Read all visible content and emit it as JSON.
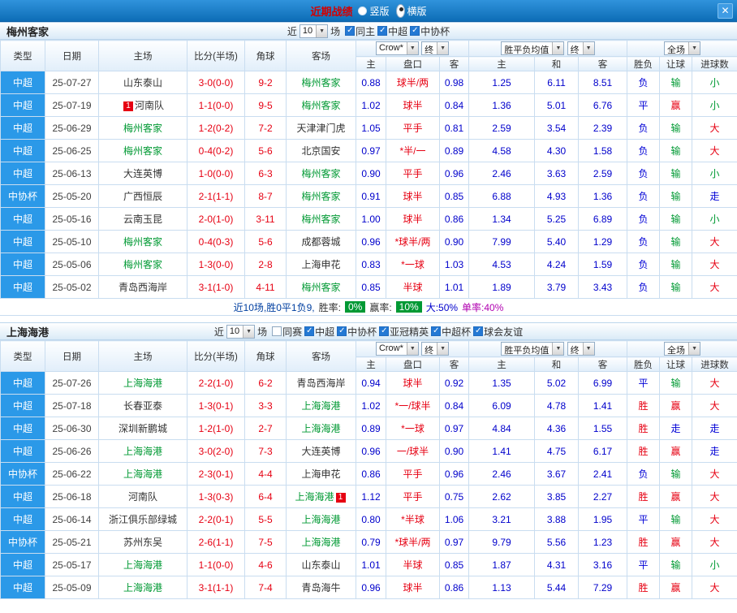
{
  "titlebar": {
    "title": "近期战绩",
    "radios": [
      {
        "label": "竖版",
        "selected": false
      },
      {
        "label": "横版",
        "selected": true
      }
    ],
    "close_icon": "✕"
  },
  "filters_common": {
    "near": "近",
    "count": "10",
    "games": "场"
  },
  "table_header": {
    "static": [
      "类型",
      "日期",
      "主场",
      "比分(半场)",
      "角球",
      "客场"
    ],
    "dd": [
      "Crow*",
      "终",
      "胜平负均值",
      "终",
      "全场"
    ],
    "sub": [
      "主",
      "盘口",
      "客",
      "主",
      "和",
      "客",
      "胜负",
      "让球",
      "进球数"
    ]
  },
  "colors": {
    "red": "#e60012",
    "green": "#009933",
    "blue": "#0000d6",
    "odds": "#0000cc",
    "date": "#404040",
    "opponent": "#333333"
  },
  "type_colors": {
    "中超": "#2b99e8",
    "中协杯": "#2b99e8"
  },
  "sections": [
    {
      "team": "梅州客家",
      "checkboxes": [
        {
          "label": "同主",
          "checked": true
        },
        {
          "label": "中超",
          "checked": true
        },
        {
          "label": "中协杯",
          "checked": true
        }
      ],
      "rows": [
        {
          "type": "中超",
          "date": "25-07-27",
          "home": {
            "name": "山东泰山"
          },
          "score": "3-0(0-0)",
          "corner": "9-2",
          "away": {
            "name": "梅州客家",
            "focus": true
          },
          "o1": "0.88",
          "pan": "球半/两",
          "o2": "0.98",
          "m1": "1.25",
          "m2": "6.11",
          "m3": "8.51",
          "res": [
            "负",
            "blue"
          ],
          "let": [
            "输",
            "green"
          ],
          "goal": [
            "小",
            "green"
          ]
        },
        {
          "type": "中超",
          "date": "25-07-19",
          "home": {
            "name": "河南队",
            "badge": "1",
            "badge_pos": "before"
          },
          "score": "1-1(0-0)",
          "corner": "9-5",
          "away": {
            "name": "梅州客家",
            "focus": true
          },
          "o1": "1.02",
          "pan": "球半",
          "o2": "0.84",
          "m1": "1.36",
          "m2": "5.01",
          "m3": "6.76",
          "res": [
            "平",
            "blue"
          ],
          "let": [
            "赢",
            "red"
          ],
          "goal": [
            "小",
            "green"
          ]
        },
        {
          "type": "中超",
          "date": "25-06-29",
          "home": {
            "name": "梅州客家",
            "focus": true
          },
          "score": "1-2(0-2)",
          "corner": "7-2",
          "away": {
            "name": "天津津门虎"
          },
          "o1": "1.05",
          "pan": "平手",
          "o2": "0.81",
          "m1": "2.59",
          "m2": "3.54",
          "m3": "2.39",
          "res": [
            "负",
            "blue"
          ],
          "let": [
            "输",
            "green"
          ],
          "goal": [
            "大",
            "red"
          ]
        },
        {
          "type": "中超",
          "date": "25-06-25",
          "home": {
            "name": "梅州客家",
            "focus": true
          },
          "score": "0-4(0-2)",
          "corner": "5-6",
          "away": {
            "name": "北京国安"
          },
          "o1": "0.97",
          "pan": "*半/一",
          "o2": "0.89",
          "m1": "4.58",
          "m2": "4.30",
          "m3": "1.58",
          "res": [
            "负",
            "blue"
          ],
          "let": [
            "输",
            "green"
          ],
          "goal": [
            "大",
            "red"
          ]
        },
        {
          "type": "中超",
          "date": "25-06-13",
          "home": {
            "name": "大连英博"
          },
          "score": "1-0(0-0)",
          "corner": "6-3",
          "away": {
            "name": "梅州客家",
            "focus": true
          },
          "o1": "0.90",
          "pan": "平手",
          "o2": "0.96",
          "m1": "2.46",
          "m2": "3.63",
          "m3": "2.59",
          "res": [
            "负",
            "blue"
          ],
          "let": [
            "输",
            "green"
          ],
          "goal": [
            "小",
            "green"
          ]
        },
        {
          "type": "中协杯",
          "date": "25-05-20",
          "home": {
            "name": "广西恒辰"
          },
          "score": "2-1(1-1)",
          "corner": "8-7",
          "away": {
            "name": "梅州客家",
            "focus": true
          },
          "o1": "0.91",
          "pan": "球半",
          "o2": "0.85",
          "m1": "6.88",
          "m2": "4.93",
          "m3": "1.36",
          "res": [
            "负",
            "blue"
          ],
          "let": [
            "输",
            "green"
          ],
          "goal": [
            "走",
            "blue"
          ]
        },
        {
          "type": "中超",
          "date": "25-05-16",
          "home": {
            "name": "云南玉昆"
          },
          "score": "2-0(1-0)",
          "corner": "3-11",
          "away": {
            "name": "梅州客家",
            "focus": true
          },
          "o1": "1.00",
          "pan": "球半",
          "o2": "0.86",
          "m1": "1.34",
          "m2": "5.25",
          "m3": "6.89",
          "res": [
            "负",
            "blue"
          ],
          "let": [
            "输",
            "green"
          ],
          "goal": [
            "小",
            "green"
          ]
        },
        {
          "type": "中超",
          "date": "25-05-10",
          "home": {
            "name": "梅州客家",
            "focus": true
          },
          "score": "0-4(0-3)",
          "corner": "5-6",
          "away": {
            "name": "成都蓉城"
          },
          "o1": "0.96",
          "pan": "*球半/两",
          "o2": "0.90",
          "m1": "7.99",
          "m2": "5.40",
          "m3": "1.29",
          "res": [
            "负",
            "blue"
          ],
          "let": [
            "输",
            "green"
          ],
          "goal": [
            "大",
            "red"
          ]
        },
        {
          "type": "中超",
          "date": "25-05-06",
          "home": {
            "name": "梅州客家",
            "focus": true
          },
          "score": "1-3(0-0)",
          "corner": "2-8",
          "away": {
            "name": "上海申花"
          },
          "o1": "0.83",
          "pan": "*一球",
          "o2": "1.03",
          "m1": "4.53",
          "m2": "4.24",
          "m3": "1.59",
          "res": [
            "负",
            "blue"
          ],
          "let": [
            "输",
            "green"
          ],
          "goal": [
            "大",
            "red"
          ]
        },
        {
          "type": "中超",
          "date": "25-05-02",
          "home": {
            "name": "青岛西海岸"
          },
          "score": "3-1(1-0)",
          "corner": "4-11",
          "away": {
            "name": "梅州客家",
            "focus": true
          },
          "o1": "0.85",
          "pan": "半球",
          "o2": "1.01",
          "m1": "1.89",
          "m2": "3.79",
          "m3": "3.43",
          "res": [
            "负",
            "blue"
          ],
          "let": [
            "输",
            "green"
          ],
          "goal": [
            "大",
            "red"
          ]
        }
      ],
      "summary": [
        {
          "text": "近10场,胜0平1负9,",
          "color": "#003fa0"
        },
        {
          "text": "胜率:",
          "color": "#333333"
        },
        {
          "text": "0%",
          "badge": true
        },
        {
          "text": "赢率:",
          "color": "#333333"
        },
        {
          "text": "10%",
          "badge": true
        },
        {
          "text": "大:50%",
          "color": "#0000cc"
        },
        {
          "text": "单率:40%",
          "color": "#b000b0"
        }
      ]
    },
    {
      "team": "上海海港",
      "checkboxes": [
        {
          "label": "同赛",
          "checked": false
        },
        {
          "label": "中超",
          "checked": true
        },
        {
          "label": "中协杯",
          "checked": true
        },
        {
          "label": "亚冠精英",
          "checked": true
        },
        {
          "label": "中超杯",
          "checked": true
        },
        {
          "label": "球会友谊",
          "checked": true
        }
      ],
      "rows": [
        {
          "type": "中超",
          "date": "25-07-26",
          "home": {
            "name": "上海海港",
            "focus": true
          },
          "score": "2-2(1-0)",
          "corner": "6-2",
          "away": {
            "name": "青岛西海岸"
          },
          "o1": "0.94",
          "pan": "球半",
          "o2": "0.92",
          "m1": "1.35",
          "m2": "5.02",
          "m3": "6.99",
          "res": [
            "平",
            "blue"
          ],
          "let": [
            "输",
            "green"
          ],
          "goal": [
            "大",
            "red"
          ]
        },
        {
          "type": "中超",
          "date": "25-07-18",
          "home": {
            "name": "长春亚泰"
          },
          "score": "1-3(0-1)",
          "corner": "3-3",
          "away": {
            "name": "上海海港",
            "focus": true
          },
          "o1": "1.02",
          "pan": "*一/球半",
          "o2": "0.84",
          "m1": "6.09",
          "m2": "4.78",
          "m3": "1.41",
          "res": [
            "胜",
            "red"
          ],
          "let": [
            "赢",
            "red"
          ],
          "goal": [
            "大",
            "red"
          ]
        },
        {
          "type": "中超",
          "date": "25-06-30",
          "home": {
            "name": "深圳新鹏城"
          },
          "score": "1-2(1-0)",
          "corner": "2-7",
          "away": {
            "name": "上海海港",
            "focus": true
          },
          "o1": "0.89",
          "pan": "*一球",
          "o2": "0.97",
          "m1": "4.84",
          "m2": "4.36",
          "m3": "1.55",
          "res": [
            "胜",
            "red"
          ],
          "let": [
            "走",
            "blue"
          ],
          "goal": [
            "走",
            "blue"
          ]
        },
        {
          "type": "中超",
          "date": "25-06-26",
          "home": {
            "name": "上海海港",
            "focus": true
          },
          "score": "3-0(2-0)",
          "corner": "7-3",
          "away": {
            "name": "大连英博"
          },
          "o1": "0.96",
          "pan": "一/球半",
          "o2": "0.90",
          "m1": "1.41",
          "m2": "4.75",
          "m3": "6.17",
          "res": [
            "胜",
            "red"
          ],
          "let": [
            "赢",
            "red"
          ],
          "goal": [
            "走",
            "blue"
          ]
        },
        {
          "type": "中协杯",
          "date": "25-06-22",
          "home": {
            "name": "上海海港",
            "focus": true
          },
          "score": "2-3(0-1)",
          "corner": "4-4",
          "away": {
            "name": "上海申花"
          },
          "o1": "0.86",
          "pan": "平手",
          "o2": "0.96",
          "m1": "2.46",
          "m2": "3.67",
          "m3": "2.41",
          "res": [
            "负",
            "blue"
          ],
          "let": [
            "输",
            "green"
          ],
          "goal": [
            "大",
            "red"
          ]
        },
        {
          "type": "中超",
          "date": "25-06-18",
          "home": {
            "name": "河南队"
          },
          "score": "1-3(0-3)",
          "corner": "6-4",
          "away": {
            "name": "上海海港",
            "focus": true,
            "badge": "1",
            "badge_pos": "after"
          },
          "o1": "1.12",
          "pan": "平手",
          "o2": "0.75",
          "m1": "2.62",
          "m2": "3.85",
          "m3": "2.27",
          "res": [
            "胜",
            "red"
          ],
          "let": [
            "赢",
            "red"
          ],
          "goal": [
            "大",
            "red"
          ]
        },
        {
          "type": "中超",
          "date": "25-06-14",
          "home": {
            "name": "浙江俱乐部绿城"
          },
          "score": "2-2(0-1)",
          "corner": "5-5",
          "away": {
            "name": "上海海港",
            "focus": true
          },
          "o1": "0.80",
          "pan": "*半球",
          "o2": "1.06",
          "m1": "3.21",
          "m2": "3.88",
          "m3": "1.95",
          "res": [
            "平",
            "blue"
          ],
          "let": [
            "输",
            "green"
          ],
          "goal": [
            "大",
            "red"
          ]
        },
        {
          "type": "中协杯",
          "date": "25-05-21",
          "home": {
            "name": "苏州东吴"
          },
          "score": "2-6(1-1)",
          "corner": "7-5",
          "away": {
            "name": "上海海港",
            "focus": true
          },
          "o1": "0.79",
          "pan": "*球半/两",
          "o2": "0.97",
          "m1": "9.79",
          "m2": "5.56",
          "m3": "1.23",
          "res": [
            "胜",
            "red"
          ],
          "let": [
            "赢",
            "red"
          ],
          "goal": [
            "大",
            "red"
          ]
        },
        {
          "type": "中超",
          "date": "25-05-17",
          "home": {
            "name": "上海海港",
            "focus": true
          },
          "score": "1-1(0-0)",
          "corner": "4-6",
          "away": {
            "name": "山东泰山"
          },
          "o1": "1.01",
          "pan": "半球",
          "o2": "0.85",
          "m1": "1.87",
          "m2": "4.31",
          "m3": "3.16",
          "res": [
            "平",
            "blue"
          ],
          "let": [
            "输",
            "green"
          ],
          "goal": [
            "小",
            "green"
          ]
        },
        {
          "type": "中超",
          "date": "25-05-09",
          "home": {
            "name": "上海海港",
            "focus": true
          },
          "score": "3-1(1-1)",
          "corner": "7-4",
          "away": {
            "name": "青岛海牛"
          },
          "o1": "0.96",
          "pan": "球半",
          "o2": "0.86",
          "m1": "1.13",
          "m2": "5.44",
          "m3": "7.29",
          "res": [
            "胜",
            "red"
          ],
          "let": [
            "赢",
            "red"
          ],
          "goal": [
            "大",
            "red"
          ]
        }
      ]
    }
  ]
}
